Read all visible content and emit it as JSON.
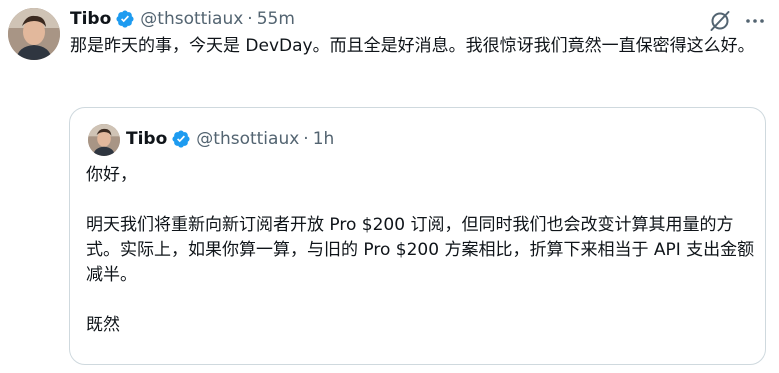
{
  "tweet": {
    "author_name": "Tibo",
    "handle": "@thsottiaux",
    "separator": "·",
    "time": "55m",
    "text": "那是昨天的事，今天是 DevDay。而且全是好消息。我很惊讶我们竟然一直保密得这么好。",
    "icons": [
      "grok-icon",
      "more-icon",
      "verified-badge-icon",
      "avatar"
    ]
  },
  "quoted_tweet": {
    "author_name": "Tibo",
    "handle": "@thsottiaux",
    "separator": "·",
    "time": "1h",
    "paragraphs": [
      "你好，",
      "明天我们将重新向新订阅者开放 Pro $200 订阅，但同时我们也会改变计算其用量的方式。实际上，如果你算一算，与旧的 Pro $200 方案相比，折算下来相当于 API 支出金额减半。",
      "既然"
    ]
  },
  "colors": {
    "text_primary": "#0f1419",
    "text_secondary": "#536471",
    "verified_blue": "#1d9bf0",
    "border": "#cfd9de"
  }
}
